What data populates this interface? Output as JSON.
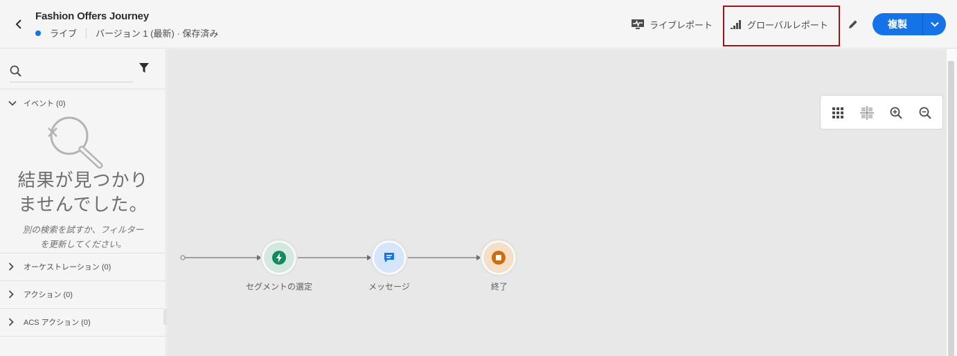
{
  "header": {
    "title": "Fashion Offers Journey",
    "status": "ライブ",
    "version": "バージョン 1 (最新) · 保存済み",
    "live_report": "ライブレポート",
    "global_report": "グローバルレポート",
    "duplicate": "複製",
    "colors": {
      "accent": "#1473e6",
      "highlight_border": "#a31313"
    }
  },
  "sidebar": {
    "search": {
      "value": "",
      "placeholder": ""
    },
    "sections": [
      {
        "label": "イベント (0)",
        "expanded": true
      },
      {
        "label": "オーケストレーション (0)",
        "expanded": false
      },
      {
        "label": "アクション (0)",
        "expanded": false
      },
      {
        "label": "ACS アクション (0)",
        "expanded": false
      }
    ],
    "empty_state": {
      "title_line1": "結果が見つかり",
      "title_line2": "ませんでした。",
      "desc_line1": "別の検索を試すか、フィルター",
      "desc_line2": "を更新してください。"
    }
  },
  "canvas": {
    "nodes": [
      {
        "label": "セグメントの選定",
        "icon": "lightning-icon",
        "color": "#138a5e"
      },
      {
        "label": "メッセージ",
        "icon": "message-icon",
        "color": "#1473e6"
      },
      {
        "label": "終了",
        "icon": "stop-icon",
        "color": "#d06b0e"
      }
    ]
  }
}
